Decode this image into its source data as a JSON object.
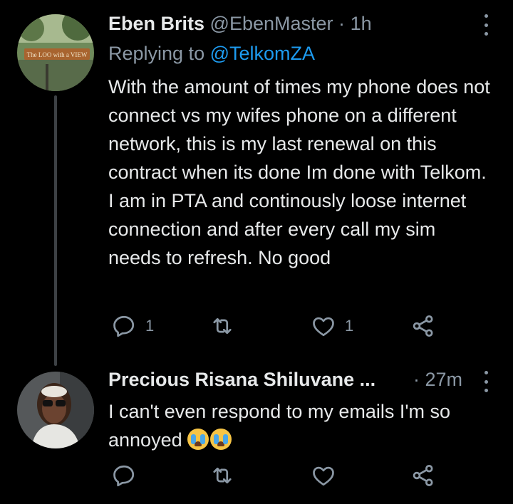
{
  "tweets": [
    {
      "name": "Eben Brits",
      "handle": "@EbenMaster",
      "dot": "·",
      "time": "1h",
      "replying_prefix": "Replying to ",
      "replying_mention": "@TelkomZA",
      "text": "With the amount of times my phone does not connect vs my wifes phone on a different network, this is my last renewal on this contract when its done Im done with Telkom. I am in PTA and continously loose internet connection and after every call my sim needs to refresh. No good",
      "reply_count": "1",
      "like_count": "1",
      "avatar_sign_text": "The LOO with a VIEW"
    },
    {
      "name": "Precious Risana Shiluvane ...",
      "dot": "·",
      "time": "27m",
      "text": "I can't even respond to my emails  I'm so annoyed",
      "emojis": [
        "loudly-crying-face",
        "loudly-crying-face"
      ]
    }
  ],
  "colors": {
    "background": "#000000",
    "text": "#e7e9ea",
    "secondary": "#8b98a5",
    "mention": "#1d9bf0"
  }
}
